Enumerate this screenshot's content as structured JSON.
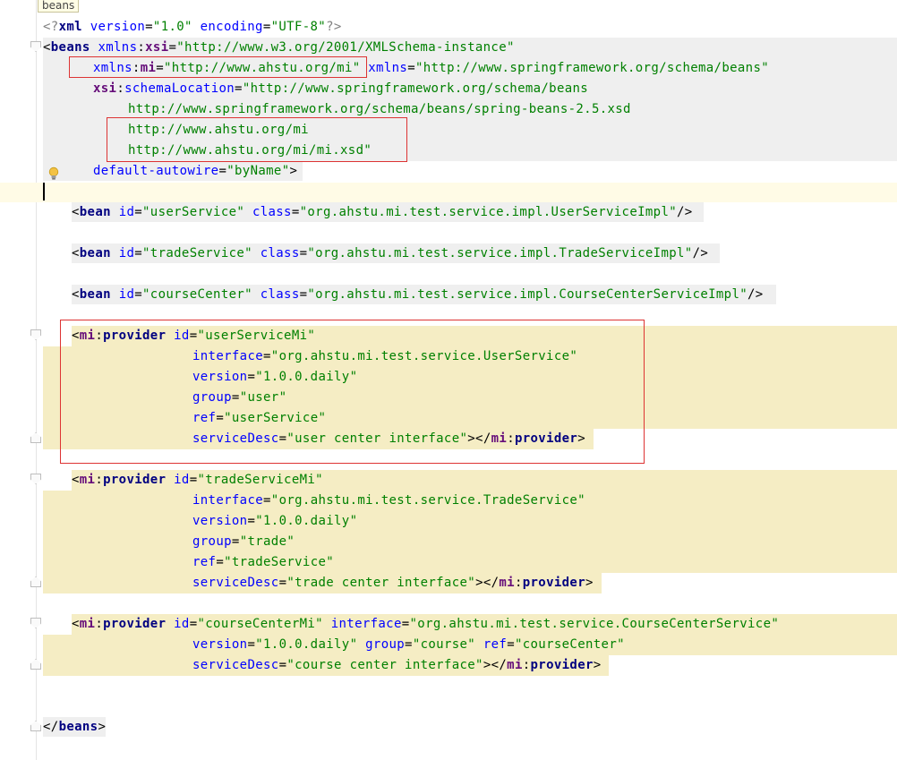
{
  "breadcrumb": "beans",
  "code": {
    "l1": {
      "open": "<?",
      "name": "xml",
      "s1": " ",
      "a1": "version",
      "eq1": "=",
      "v1": "\"1.0\"",
      "s2": " ",
      "a2": "encoding",
      "eq2": "=",
      "v2": "\"UTF-8\"",
      "close": "?>"
    },
    "l2": {
      "open": "<",
      "tag": "beans",
      "s1": " ",
      "nsp": "xmlns",
      "colon": ":",
      "ns": "xsi",
      "eq": "=",
      "val": "\"http://www.w3.org/2001/XMLSchema-instance\""
    },
    "l3": {
      "nsp": "xmlns",
      "colon": ":",
      "ns": "mi",
      "eq": "=",
      "val": "\"http://www.ahstu.org/mi\"",
      "s1": " ",
      "a2": "xmlns",
      "eq2": "=",
      "val2": "\"http://www.springframework.org/schema/beans\""
    },
    "l4": {
      "ns": "xsi",
      "colon": ":",
      "attr": "schemaLocation",
      "eq": "=",
      "val": "\"http://www.springframework.org/schema/beans"
    },
    "l5": {
      "val": "http://www.springframework.org/schema/beans/spring-beans-2.5.xsd"
    },
    "l6": {
      "val": "http://www.ahstu.org/mi"
    },
    "l7": {
      "val": "http://www.ahstu.org/mi/mi.xsd\""
    },
    "l8": {
      "attr": "default-autowire",
      "eq": "=",
      "val": "\"byName\"",
      "close": ">"
    },
    "l10": {
      "open": "<",
      "tag": "bean",
      "s1": " ",
      "a1": "id",
      "eq1": "=",
      "v1": "\"userService\"",
      "s2": " ",
      "a2": "class",
      "eq2": "=",
      "v2": "\"org.ahstu.mi.test.service.impl.UserServiceImpl\"",
      "close": "/>"
    },
    "l12": {
      "open": "<",
      "tag": "bean",
      "s1": " ",
      "a1": "id",
      "eq1": "=",
      "v1": "\"tradeService\"",
      "s2": " ",
      "a2": "class",
      "eq2": "=",
      "v2": "\"org.ahstu.mi.test.service.impl.TradeServiceImpl\"",
      "close": "/>"
    },
    "l14": {
      "open": "<",
      "tag": "bean",
      "s1": " ",
      "a1": "id",
      "eq1": "=",
      "v1": "\"courseCenter\"",
      "s2": " ",
      "a2": "class",
      "eq2": "=",
      "v2": "\"org.ahstu.mi.test.service.impl.CourseCenterServiceImpl\"",
      "close": "/>"
    },
    "p1": [
      {
        "open": "<",
        "ns": "mi",
        "colon": ":",
        "tag": "provider",
        "s1": " ",
        "attr": "id",
        "eq": "=",
        "val": "\"userServiceMi\""
      },
      {
        "attr": "interface",
        "eq": "=",
        "val": "\"org.ahstu.mi.test.service.UserService\""
      },
      {
        "attr": "version",
        "eq": "=",
        "val": "\"1.0.0.daily\""
      },
      {
        "attr": "group",
        "eq": "=",
        "val": "\"user\""
      },
      {
        "attr": "ref",
        "eq": "=",
        "val": "\"userService\""
      },
      {
        "attr": "serviceDesc",
        "eq": "=",
        "val": "\"user center interface\"",
        "mid": "></",
        "ns": "mi",
        "colon": ":",
        "tag": "provider",
        "close": ">"
      }
    ],
    "p2": [
      {
        "open": "<",
        "ns": "mi",
        "colon": ":",
        "tag": "provider",
        "s1": " ",
        "attr": "id",
        "eq": "=",
        "val": "\"tradeServiceMi\""
      },
      {
        "attr": "interface",
        "eq": "=",
        "val": "\"org.ahstu.mi.test.service.TradeService\""
      },
      {
        "attr": "version",
        "eq": "=",
        "val": "\"1.0.0.daily\""
      },
      {
        "attr": "group",
        "eq": "=",
        "val": "\"trade\""
      },
      {
        "attr": "ref",
        "eq": "=",
        "val": "\"tradeService\""
      },
      {
        "attr": "serviceDesc",
        "eq": "=",
        "val": "\"trade center interface\"",
        "mid": "></",
        "ns": "mi",
        "colon": ":",
        "tag": "provider",
        "close": ">"
      }
    ],
    "p3": [
      {
        "open": "<",
        "ns": "mi",
        "colon": ":",
        "tag": "provider",
        "s1": " ",
        "attr": "id",
        "eq": "=",
        "val": "\"courseCenterMi\"",
        "s2": " ",
        "attr2": "interface",
        "eq2": "=",
        "val2": "\"org.ahstu.mi.test.service.CourseCenterService\""
      },
      {
        "attr": "version",
        "eq": "=",
        "val": "\"1.0.0.daily\"",
        "s1": " ",
        "attr2": "group",
        "eq2": "=",
        "val2": "\"course\"",
        "s2": " ",
        "attr3": "ref",
        "eq3": "=",
        "val3": "\"courseCenter\""
      },
      {
        "attr": "serviceDesc",
        "eq": "=",
        "val": "\"course center interface\"",
        "mid": "></",
        "ns": "mi",
        "colon": ":",
        "tag": "provider",
        "close": ">"
      }
    ],
    "end": {
      "open": "</",
      "tag": "beans",
      "close": ">"
    }
  }
}
